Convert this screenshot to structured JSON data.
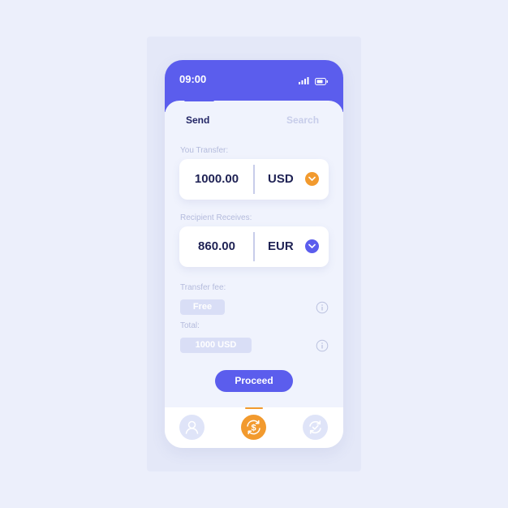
{
  "status_bar": {
    "time": "09:00"
  },
  "tabs": {
    "send": "Send",
    "search": "Search"
  },
  "transfer": {
    "label": "You Transfer:",
    "amount": "1000.00",
    "currency": "USD"
  },
  "receive": {
    "label": "Recipient Receives:",
    "amount": "860.00",
    "currency": "EUR"
  },
  "fee": {
    "label": "Transfer fee:",
    "value": "Free"
  },
  "total": {
    "label": "Total:",
    "value": "1000 USD"
  },
  "actions": {
    "proceed": "Proceed"
  },
  "icons": {
    "signal": "signal-icon",
    "battery": "battery-icon",
    "transfer_toggle": "chevron-down-icon",
    "receive_toggle": "chevron-down-icon",
    "fee_info": "info-icon",
    "total_info": "info-icon",
    "nav_profile": "user-icon",
    "nav_exchange": "dollar-exchange-icon",
    "nav_refresh": "refresh-icon"
  },
  "colors": {
    "primary": "#5b5ded",
    "accent": "#f29a2e",
    "text_dark": "#1f2254",
    "muted": "#b4bbdc"
  }
}
